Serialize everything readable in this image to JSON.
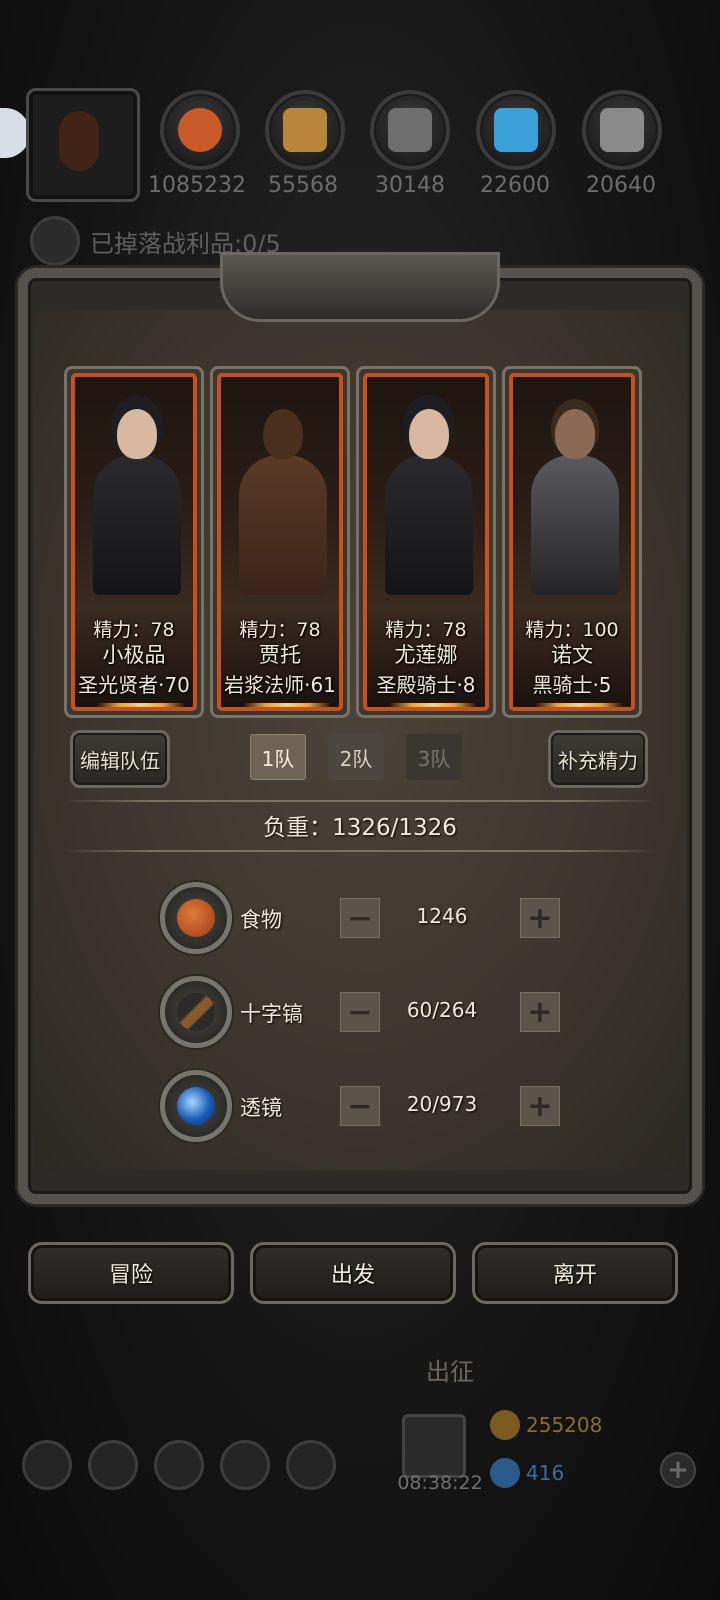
{
  "resources": [
    {
      "icon": "food-icon",
      "value": "1085232",
      "color": "#c85a2a"
    },
    {
      "icon": "wood-icon",
      "value": "55568",
      "color": "#b7863a"
    },
    {
      "icon": "stone-icon",
      "value": "30148",
      "color": "#7a7a7a"
    },
    {
      "icon": "crystal-icon",
      "value": "22600",
      "color": "#3aa0d8"
    },
    {
      "icon": "iron-icon",
      "value": "20640",
      "color": "#8a8a8a"
    }
  ],
  "loot": {
    "text": "已掉落战利品:0/5"
  },
  "heroes": [
    {
      "energy": "精力：78",
      "name": "小极品",
      "class": "圣光贤者·70"
    },
    {
      "energy": "精力：78",
      "name": "贾托",
      "class": "岩浆法师·61"
    },
    {
      "energy": "精力：78",
      "name": "尤莲娜",
      "class": "圣殿骑士·8"
    },
    {
      "energy": "精力：100",
      "name": "诺文",
      "class": "黑骑士·5"
    }
  ],
  "team": {
    "edit_label": "编辑队伍",
    "tabs": [
      "1队",
      "2队",
      "3队"
    ],
    "active_tab": "1队",
    "refill_label": "补充精力"
  },
  "weight": {
    "text": "负重：1326/1326"
  },
  "supplies": [
    {
      "icon": "food-icon",
      "label": "食物",
      "value": "1246"
    },
    {
      "icon": "pickaxe-icon",
      "label": "十字镐",
      "value": "60/264"
    },
    {
      "icon": "lens-icon",
      "label": "透镜",
      "value": "20/973"
    }
  ],
  "actions": {
    "adventure": "冒险",
    "depart": "出发",
    "leave": "离开"
  },
  "background": {
    "title": "出征",
    "timer": "08:38:22",
    "gold": "255208",
    "gems": "416"
  },
  "colors": {
    "accent": "#c9501a",
    "gold": "#9c7a2e",
    "gem": "#4a86c8"
  }
}
